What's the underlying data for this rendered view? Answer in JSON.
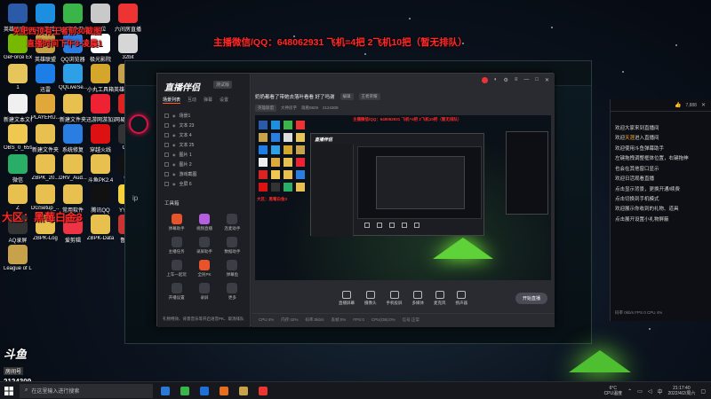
{
  "overlay": {
    "title_left_line1": "免肥西顶有王者前30截图",
    "title_left_line2": "直播时间下午3-凌晨1",
    "contact": "主播微信/QQ：648062931  飞机=4把 2飞机10把（暂无排队）",
    "region": "大区：黑莓白金3"
  },
  "desktop_icons": [
    {
      "label": "英雄联盟WeGame版",
      "color": "#2b5aa8"
    },
    {
      "label": "QQ游戏",
      "color": "#1d8fe0"
    },
    {
      "label": "360安全卫士",
      "color": "#3ab54a"
    },
    {
      "label": "64位",
      "color": "#c9c9c9"
    },
    {
      "label": "六间房直播",
      "color": "#e33"
    },
    {
      "label": "GeForce Experience",
      "color": "#76b900"
    },
    {
      "label": "英雄联盟",
      "color": "#c8a24a"
    },
    {
      "label": "QQ浏览器",
      "color": "#2a7de1"
    },
    {
      "label": "极光影院",
      "color": "#fff"
    },
    {
      "label": "32bit",
      "color": "#d6d6d6"
    },
    {
      "label": "1",
      "color": "#e6c55a"
    },
    {
      "label": "迅雷",
      "color": "#1e7ee8"
    },
    {
      "label": "QQLiveSe...",
      "color": "#2da0e8"
    },
    {
      "label": "小丸工具箱",
      "color": "#d4a72c"
    },
    {
      "label": "英雄联盟WeGame版",
      "color": "#c8a24a"
    },
    {
      "label": "新建文本文档",
      "color": "#f0f0f0"
    },
    {
      "label": "PLAYERU... BATTLEGR...",
      "color": "#e0a83a"
    },
    {
      "label": "新建文件夹",
      "color": "#e8c050"
    },
    {
      "label": "迅游网游加速器",
      "color": "#e23"
    },
    {
      "label": "网易云音乐",
      "color": "#d22"
    },
    {
      "label": "OBS_0_659",
      "color": "#f0c850"
    },
    {
      "label": "新建文件夹",
      "color": "#e8c050"
    },
    {
      "label": "系统修复",
      "color": "#2a7de1"
    },
    {
      "label": "穿越火线",
      "color": "#d11"
    },
    {
      "label": "OBS",
      "color": "#333"
    },
    {
      "label": "微信",
      "color": "#2aae67"
    },
    {
      "label": "ZBPK_20...",
      "color": "#e8c050"
    },
    {
      "label": "DRV_Aud...",
      "color": "#e8c050"
    },
    {
      "label": "斗鱼PK2.4",
      "color": "#e8c050"
    },
    {
      "label": "QQ",
      "color": "#111"
    },
    {
      "label": "Z",
      "color": "#e8c050"
    },
    {
      "label": "DGSetup_...",
      "color": "#e8c050"
    },
    {
      "label": "常用软件",
      "color": "#e8c050"
    },
    {
      "label": "腾讯QQ",
      "color": "#111"
    },
    {
      "label": "YY语音",
      "color": "#f5d23a"
    },
    {
      "label": "AQ录屏",
      "color": "#333"
    },
    {
      "label": "ZBPK-Log",
      "color": "#e8c050"
    },
    {
      "label": "爱剪辑",
      "color": "#e34"
    },
    {
      "label": "ZBPK-Data",
      "color": "#e8c050"
    },
    {
      "label": "鲁大师",
      "color": "#c33"
    },
    {
      "label": "League of Legends",
      "color": "#c8a24a"
    }
  ],
  "watermark": {
    "brand": "斗鱼",
    "sub": "房间号",
    "room": "2124309"
  },
  "app": {
    "logo": "直播伴侣",
    "version": "测试版",
    "left_tabs": [
      "场景列表",
      "互动",
      "弹幕",
      "设置"
    ],
    "scenes": [
      "场景1",
      "文本 23",
      "文本 4",
      "文本 25",
      "图片 1",
      "图片 2",
      "游戏截图",
      "全屏 6"
    ],
    "tool_title": "工具箱",
    "tools": [
      "弹幕助手",
      "视频直播",
      "连麦助手",
      "主播任务",
      "录屏助手",
      "数据助手",
      "上车一起玩",
      "全民PK",
      "弹幕鱼",
      "开播设置",
      "录屏",
      "更多"
    ],
    "footer_note": "礼物特效、背景音乐等开启语音PK、取消排队",
    "stream_title": "奶奶都看了带她去落叶看看 好了吗谢",
    "title_chips": [
      "编辑",
      "王者荣耀"
    ],
    "info": [
      "英雄联盟",
      "大神房字",
      "观看0829",
      "2124309"
    ],
    "bottom_buttons": [
      "直播屏幕",
      "摄像头",
      "手机投屏",
      "多媒体",
      "麦克风",
      "扬声器"
    ],
    "start_label": "开始直播",
    "status": [
      "CPU:4%",
      "内存:42%",
      "码率:0kb/s",
      "丢帧:0%",
      "FPS:0",
      "CPU(OB):0%",
      "信号:正常"
    ]
  },
  "preview_texts": {
    "red_line": "主播微信/QQ：648062931 飞机=4把 2飞机10把（暂无排队）",
    "mini_logo": "直播伴侣",
    "region_small": "大区：黑莓白金3"
  },
  "chat": {
    "stats": "7,888",
    "rows": [
      {
        "text": "欢迎大家来到直播间",
        "hl": ""
      },
      {
        "text": "欢迎",
        "hl": "天涯",
        "tail": "进入直播间"
      },
      {
        "text": "欢迎使用斗鱼弹幕助手",
        "hl": ""
      },
      {
        "text": "左键拖拽调整框体位置，右键拖伸",
        "hl": ""
      },
      {
        "text": "也会在其他窗口显示",
        "hl": ""
      },
      {
        "text": "欢迎日活观看直播",
        "hl": ""
      },
      {
        "text": "点击显示背景，更换开通/续费",
        "hl": ""
      },
      {
        "text": "点击切换到手机模式",
        "hl": ""
      },
      {
        "text": "欢迎展示你收到的礼物、道具",
        "hl": ""
      },
      {
        "text": "点击展开设置小礼物屏蔽",
        "hl": ""
      }
    ],
    "footer": "码率 0kb/s  FPS 0  CPU 4%"
  },
  "taskbar": {
    "search_placeholder": "在这里输入进行搜索",
    "apps": [
      "#2b79d6",
      "#3ab54a",
      "#1e6fd9",
      "#e96d1f",
      "#c8a24a",
      "#e33"
    ],
    "weather_temp": "6°C",
    "weather_desc": "CPU温度",
    "time": "21:17:40",
    "date": "2022/4/2/周六"
  },
  "colors": {
    "overlay_red": "#ff2a2a",
    "tent_green": "#5fd23a",
    "chat_highlight": "#ffb22e"
  }
}
